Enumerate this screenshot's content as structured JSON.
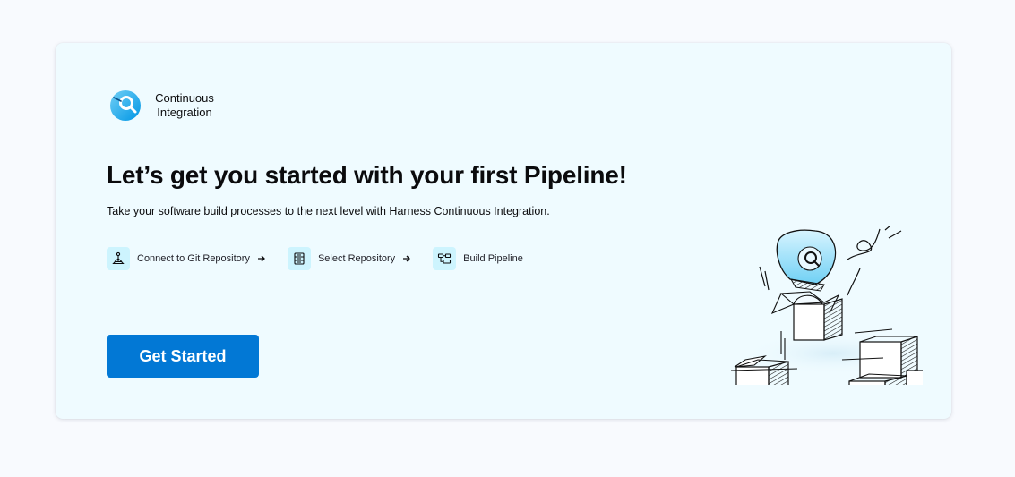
{
  "module": {
    "name_line1": "Continuous",
    "name_line2": "Integration",
    "icon": "ci-icon"
  },
  "welcome": {
    "title": "Let’s get you started with your first Pipeline!",
    "subtitle": "Take your software build processes to the next level with Harness Continuous Integration."
  },
  "steps": [
    {
      "label": "Connect to Git Repository",
      "icon": "git-repo-icon"
    },
    {
      "label": "Select Repository",
      "icon": "repository-icon"
    },
    {
      "label": "Build Pipeline",
      "icon": "pipeline-icon"
    }
  ],
  "cta": {
    "label": "Get Started"
  },
  "colors": {
    "page_bg": "#f8fafe",
    "card_bg": "#effbff",
    "primary": "#0278d5",
    "step_icon_bg": "#cdf4fe",
    "ci_gradient_start": "#71cff5",
    "ci_gradient_end": "#0096e5"
  }
}
